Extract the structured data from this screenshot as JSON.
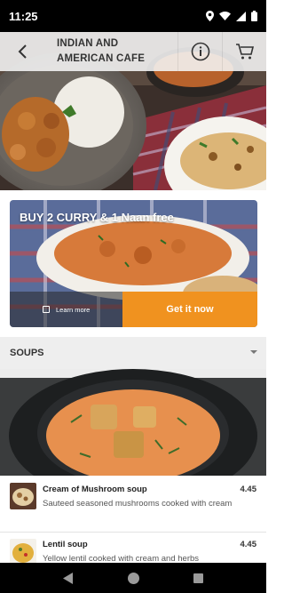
{
  "status_bar": {
    "time": "11:25",
    "icons": [
      "location-icon",
      "wifi-icon",
      "signal-icon",
      "battery-icon"
    ]
  },
  "header": {
    "title_line1": "INDIAN AND",
    "title_line2": "AMERICAN CAFE",
    "icons": [
      "back-arrow-icon",
      "info-icon",
      "cart-icon"
    ]
  },
  "promo": {
    "title": "BUY 2 CURRY & 1 Naan free",
    "learn_more": "Learn more",
    "cta": "Get it now",
    "cta_color": "#f0921f"
  },
  "section": {
    "title": "SOUPS"
  },
  "menu_items": [
    {
      "name": "Cream of Mushroom soup",
      "price": "4.45",
      "description": "Sauteed seasoned mushrooms cooked with cream"
    },
    {
      "name": "Lentil soup",
      "price": "4.45",
      "description": "Yellow lentil cooked with cream and herbs"
    }
  ],
  "nav_bar": {
    "icons": [
      "back-triangle-icon",
      "home-circle-icon",
      "recents-square-icon"
    ]
  }
}
